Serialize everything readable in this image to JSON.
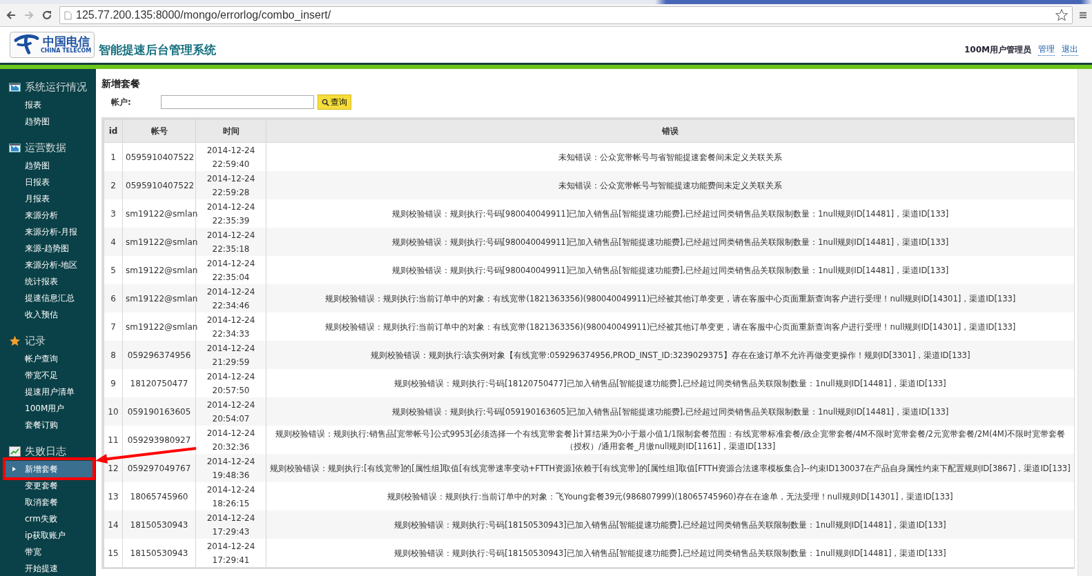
{
  "browser": {
    "url": "125.77.200.135:8000/mongo/errorlog/combo_insert/"
  },
  "header": {
    "logo_cn": "中国电信",
    "logo_en": "CHINA TELECOM",
    "title": "智能提速后台管理系统",
    "user": "100M用户管理员",
    "links": [
      "管理",
      "退出"
    ]
  },
  "sidebar": [
    {
      "title": "系统运行情况",
      "kind": "screen",
      "items": [
        {
          "label": "报表",
          "selected": false
        },
        {
          "label": "趋势图",
          "selected": false
        }
      ]
    },
    {
      "title": "运营数据",
      "kind": "screen",
      "items": [
        {
          "label": "趋势图",
          "selected": false
        },
        {
          "label": "日报表",
          "selected": false
        },
        {
          "label": "月报表",
          "selected": false
        },
        {
          "label": "来源分析",
          "selected": false
        },
        {
          "label": "来源分析-月报",
          "selected": false
        },
        {
          "label": "来源-趋势图",
          "selected": false
        },
        {
          "label": "来源分析-地区",
          "selected": false
        },
        {
          "label": "统计报表",
          "selected": false
        },
        {
          "label": "提速信息汇总",
          "selected": false
        },
        {
          "label": "收入预估",
          "selected": false
        }
      ]
    },
    {
      "title": "记录",
      "kind": "star",
      "items": [
        {
          "label": "帐户查询",
          "selected": false
        },
        {
          "label": "带宽不足",
          "selected": false
        },
        {
          "label": "提速用户清单",
          "selected": false
        },
        {
          "label": "100M用户",
          "selected": false
        },
        {
          "label": "套餐订购",
          "selected": false
        }
      ]
    },
    {
      "title": "失败日志",
      "kind": "chart",
      "items": [
        {
          "label": "新增套餐",
          "selected": true
        },
        {
          "label": "变更套餐",
          "selected": false
        },
        {
          "label": "取消套餐",
          "selected": false
        },
        {
          "label": "crm失败",
          "selected": false
        },
        {
          "label": "ip获取账户",
          "selected": false
        },
        {
          "label": "带宽",
          "selected": false
        },
        {
          "label": "开始提速",
          "selected": false
        }
      ]
    }
  ],
  "page_title": "新增套餐",
  "search": {
    "label": "帐户:",
    "button": "查询"
  },
  "table": {
    "columns": [
      "id",
      "帐号",
      "时间",
      "错误"
    ],
    "rows": [
      [
        "1",
        "0595910407522",
        "2014-12-24 22:59:40",
        "未知错误：公众宽带帐号与省智能提速套餐间未定义关联关系"
      ],
      [
        "2",
        "0595910407522",
        "2014-12-24 22:59:28",
        "未知错误：公众宽带帐号与智能提速功能费间未定义关联关系"
      ],
      [
        "3",
        "sm19122@smlan",
        "2014-12-24 22:35:39",
        "规则校验错误：规则执行:号码[980040049911]已加入销售品[智能提速功能费],已经超过同类销售品关联限制数量：1null规则ID[14481]，渠道ID[133]"
      ],
      [
        "4",
        "sm19122@smlan",
        "2014-12-24 22:35:18",
        "规则校验错误：规则执行:号码[980040049911]已加入销售品[智能提速功能费],已经超过同类销售品关联限制数量：1null规则ID[14481]，渠道ID[133]"
      ],
      [
        "5",
        "sm19122@smlan",
        "2014-12-24 22:35:04",
        "规则校验错误：规则执行:号码[980040049911]已加入销售品[智能提速功能费],已经超过同类销售品关联限制数量：1null规则ID[14481]，渠道ID[133]"
      ],
      [
        "6",
        "sm19122@smlan",
        "2014-12-24 22:34:46",
        "规则校验错误：规则执行:当前订单中的对象：有线宽带(1821363356)(980040049911)已经被其他订单变更，请在客服中心页面重新查询客户进行受理！null规则ID[14301]，渠道ID[133]"
      ],
      [
        "7",
        "sm19122@smlan",
        "2014-12-24 22:34:33",
        "规则校验错误：规则执行:当前订单中的对象：有线宽带(1821363356)(980040049911)已经被其他订单变更，请在客服中心页面重新查询客户进行受理！null规则ID[14301]，渠道ID[133]"
      ],
      [
        "8",
        "059296374956",
        "2014-12-24 21:29:59",
        "规则校验错误：规则执行:该实例对象【有线宽带:059296374956,PROD_INST_ID:3239029375】存在在途订单不允许再做变更操作！规则ID[3301]，渠道ID[133]"
      ],
      [
        "9",
        "18120750477",
        "2014-12-24 20:57:50",
        "规则校验错误：规则执行:号码[18120750477]已加入销售品[智能提速功能费],已经超过同类销售品关联限制数量：1null规则ID[14481]，渠道ID[133]"
      ],
      [
        "10",
        "059190163605",
        "2014-12-24 20:54:07",
        "规则校验错误：规则执行:号码[059190163605]已加入销售品[智能提速功能费],已经超过同类销售品关联限制数量：1null规则ID[14481]，渠道ID[133]"
      ],
      [
        "11",
        "059293980927",
        "2014-12-24 20:32:36",
        "规则校验错误：规则执行:销售品[宽带帐号]公式9953[必须选择一个有线宽带套餐]计算结果为0小于最小值1/1限制套餐范围：有线宽带标准套餐/政企宽带套餐/4M不限时宽带套餐/2元宽带套餐/2M(4M)不限时宽带套餐（授权）/通用套餐_月缴null规则ID[1161]，渠道ID[133]"
      ],
      [
        "12",
        "059297049767",
        "2014-12-24 19:48:36",
        "规则校验错误：规则执行:[有线宽带]的[属性组]取值[有线宽带速率变动+FTTH资源]依赖于[有线宽带]的[属性组]取值[FTTH资源合法速率模板集合]--约束ID130037在产品自身属性约束下配置规则ID[3867]，渠道ID[133]"
      ],
      [
        "13",
        "18065745960",
        "2014-12-24 18:26:15",
        "规则校验错误：规则执行:当前订单中的对象：飞Young套餐39元(986807999)(18065745960)存在在途单，无法受理！null规则ID[14301]，渠道ID[133]"
      ],
      [
        "14",
        "18150530943",
        "2014-12-24 17:29:43",
        "规则校验错误：规则执行:号码[18150530943]已加入销售品[智能提速功能费],已经超过同类销售品关联限制数量：1null规则ID[14481]，渠道ID[133]"
      ],
      [
        "15",
        "18150530943",
        "2014-12-24 17:29:41",
        "规则校验错误：规则执行:号码[18150530943]已加入销售品[智能提速功能费],已经超过同类销售品关联限制数量：1null规则ID[14481]，渠道ID[133]"
      ]
    ]
  }
}
